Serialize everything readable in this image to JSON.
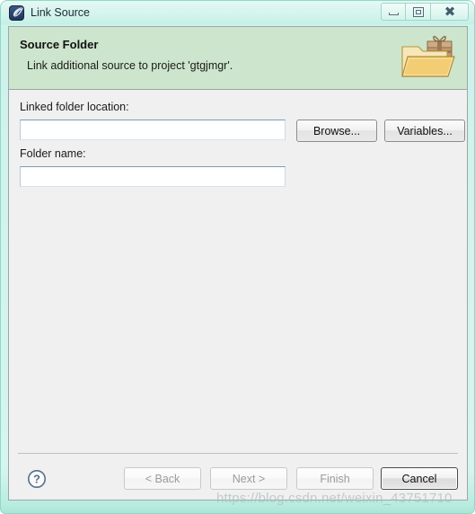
{
  "window": {
    "title": "Link Source",
    "icon": "eclipse-app-icon",
    "controls": {
      "minimize": "minimize-icon",
      "maximize": "maximize-icon",
      "close": "close-icon"
    }
  },
  "banner": {
    "title": "Source Folder",
    "description": "Link additional source to project 'gtgjmgr'.",
    "icon": "linked-folder-icon",
    "background_color": "#cde5cd"
  },
  "form": {
    "location": {
      "label": "Linked folder location:",
      "value": "",
      "placeholder": ""
    },
    "browse_button": "Browse...",
    "variables_button": "Variables...",
    "folder_name": {
      "label": "Folder name:",
      "value": "",
      "placeholder": ""
    }
  },
  "footer": {
    "help_icon": "help-question-icon",
    "buttons": [
      {
        "label": "< Back",
        "enabled": false,
        "default": false
      },
      {
        "label": "Next >",
        "enabled": false,
        "default": false
      },
      {
        "label": "Finish",
        "enabled": false,
        "default": false
      },
      {
        "label": "Cancel",
        "enabled": true,
        "default": true
      }
    ]
  },
  "watermark": "https://blog.csdn.net/weixin_43751710"
}
